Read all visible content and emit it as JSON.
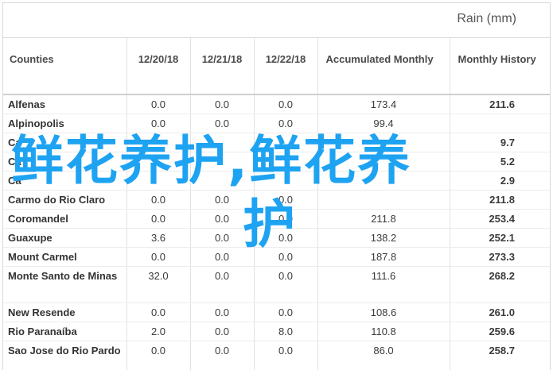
{
  "table": {
    "caption": "Rain (mm)",
    "columns": [
      "Counties",
      "12/20/18",
      "12/21/18",
      "12/22/18",
      "Accumulated Monthly",
      "Monthly History"
    ],
    "rows": [
      {
        "county": "Alfenas",
        "d1": "0.0",
        "d2": "0.0",
        "d3": "0.0",
        "accum": "173.4",
        "history": "211.6"
      },
      {
        "county": "Alpinopolis",
        "d1": "0.0",
        "d2": "0.0",
        "d3": "0.0",
        "accum": "99.4",
        "history": ""
      },
      {
        "county": "Ca",
        "d1": "",
        "d2": "",
        "d3": "",
        "accum": "",
        "history": "9.7"
      },
      {
        "county": "Ca",
        "d1": "",
        "d2": "",
        "d3": "",
        "accum": "",
        "history": "5.2"
      },
      {
        "county": "Ca",
        "d1": "",
        "d2": "",
        "d3": "",
        "accum": "",
        "history": "2.9"
      },
      {
        "county": "Carmo do Rio Claro",
        "d1": "0.0",
        "d2": "0.0",
        "d3": "0.0",
        "accum": "",
        "history": "211.8"
      },
      {
        "county": "Coromandel",
        "d1": "0.0",
        "d2": "0.0",
        "d3": "0.0",
        "accum": "211.8",
        "history": "253.4"
      },
      {
        "county": "Guaxupe",
        "d1": "3.6",
        "d2": "0.0",
        "d3": "0.0",
        "accum": "138.2",
        "history": "252.1"
      },
      {
        "county": "Mount Carmel",
        "d1": "0.0",
        "d2": "0.0",
        "d3": "0.0",
        "accum": "187.8",
        "history": "273.3"
      },
      {
        "county": "Monte Santo de Minas",
        "d1": "32.0",
        "d2": "0.0",
        "d3": "0.0",
        "accum": "111.6",
        "history": "268.2"
      },
      {
        "county": "New Resende",
        "d1": "0.0",
        "d2": "0.0",
        "d3": "0.0",
        "accum": "108.6",
        "history": "261.0"
      },
      {
        "county": "Rio Paranaíba",
        "d1": "2.0",
        "d2": "0.0",
        "d3": "8.0",
        "accum": "110.8",
        "history": "259.6"
      },
      {
        "county": "Sao Jose do Rio Pardo",
        "d1": "0.0",
        "d2": "0.0",
        "d3": "0.0",
        "accum": "86.0",
        "history": "258.7"
      }
    ]
  },
  "watermark": {
    "line1": "鲜花养护,鲜花养",
    "line2": "护"
  }
}
